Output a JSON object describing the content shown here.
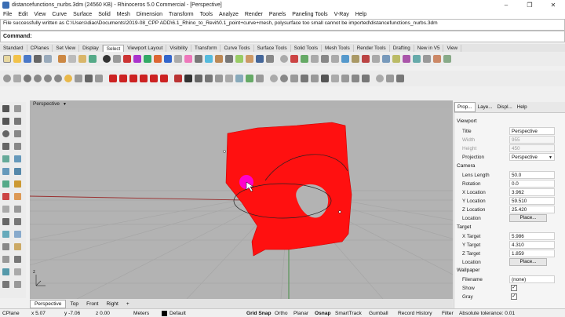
{
  "window": {
    "title": "distancefunctions_nurbs.3dm (24560 KB) - Rhinoceros 5.0 Commercial - [Perspective]",
    "controls": [
      "–",
      "❐",
      "✕"
    ]
  },
  "menu": [
    "File",
    "Edit",
    "View",
    "Curve",
    "Surface",
    "Solid",
    "Mesh",
    "Dimension",
    "Transform",
    "Tools",
    "Analyze",
    "Render",
    "Panels",
    "Paneling Tools",
    "V-Ray",
    "Help"
  ],
  "history_text": "File successfully written as C:\\Users\\diao\\Documents\\2019-08_CPP ADD\\6.1_Rhino_to_Revit\\0.1_point+curve+mesh, polysurface too small cannot be imported\\distancefunctions_nurbs.3dm",
  "command_label": "Command:",
  "toolbar_tabs": [
    "Standard",
    "CPlanes",
    "Set View",
    "Display",
    "Select",
    "Viewport Layout",
    "Visibility",
    "Transform",
    "Curve Tools",
    "Surface Tools",
    "Solid Tools",
    "Mesh Tools",
    "Render Tools",
    "Drafting",
    "New in V5",
    "View"
  ],
  "active_toolbar_tab": "Select",
  "viewport": {
    "title": "Perspective",
    "tabs": [
      "Perspective",
      "Top",
      "Front",
      "Right"
    ],
    "add_tab": "+",
    "active_tab": "Perspective",
    "axis_label": "z"
  },
  "status": {
    "cplane": "CPlane",
    "x": "x 5.07",
    "y": "y -7.06",
    "z": "z 0.00",
    "units": "Meters",
    "layer": "Default",
    "toggles": [
      "Grid Snap",
      "Ortho",
      "Planar",
      "Osnap",
      "SmartTrack",
      "Gumball",
      "Record History",
      "Filter"
    ],
    "tolerance": "Absolute tolerance: 0.01"
  },
  "panel": {
    "tabs": [
      "Prop...",
      "Laye...",
      "Displ...",
      "Help"
    ],
    "viewport_section": "Viewport",
    "viewport_props": [
      {
        "label": "Title",
        "value": "Perspective"
      },
      {
        "label": "Width",
        "value": "955"
      },
      {
        "label": "Height",
        "value": "450"
      },
      {
        "label": "Projection",
        "value": "Perspective"
      }
    ],
    "camera_section": "Camera",
    "camera_props": [
      {
        "label": "Lens Length",
        "value": "50.0"
      },
      {
        "label": "Rotation",
        "value": "0.0"
      },
      {
        "label": "X Location",
        "value": "3.962"
      },
      {
        "label": "Y Location",
        "value": "59.510"
      },
      {
        "label": "Z Location",
        "value": "25.420"
      }
    ],
    "location_label": "Location",
    "place_button": "Place...",
    "target_section": "Target",
    "target_props": [
      {
        "label": "X Target",
        "value": "5.986"
      },
      {
        "label": "Y Target",
        "value": "4.310"
      },
      {
        "label": "Z Target",
        "value": "1.859"
      }
    ],
    "wallpaper_section": "Wallpaper",
    "wallpaper_props": [
      {
        "label": "Filename",
        "value": "(none)"
      },
      {
        "label": "Show",
        "value": "✓"
      },
      {
        "label": "Gray",
        "value": "✓"
      }
    ]
  },
  "colors": {
    "surface": "#ff1010",
    "cursor_highlight": "#ff00cc",
    "viewport_bg": "#b3b3b3",
    "x_axis": "#9a3030",
    "z_axis": "#3a8a3a"
  }
}
